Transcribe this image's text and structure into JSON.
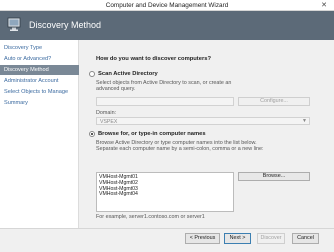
{
  "window": {
    "title": "Computer and Device Management Wizard"
  },
  "header": {
    "title": "Discovery Method"
  },
  "nav": {
    "items": [
      {
        "label": "Discovery Type",
        "active": false
      },
      {
        "label": "Auto or Advanced?",
        "active": false
      },
      {
        "label": "Discovery Method",
        "active": true
      },
      {
        "label": "Administrator Account",
        "active": false
      },
      {
        "label": "Select Objects to Manage",
        "active": false
      },
      {
        "label": "Summary",
        "active": false
      }
    ]
  },
  "main": {
    "question": "How do you want to discover computers?",
    "scan_ad": {
      "label": "Scan Active Directory",
      "description": "Select objects from Active Directory to scan, or create an advanced query.",
      "configure_label": "Configure...",
      "domain_label": "Domain:",
      "domain_value": "VSPEX"
    },
    "browse": {
      "label": "Browse for, or type-in computer names",
      "description": "Browse Active Directory or type computer names into the list below. Separate each computer name by a semi-colon, comma or a new line:",
      "names": [
        "VMHost-Mgmt01",
        "VMHost-Mgmt02",
        "VMHost-Mgmt03",
        "VMHost-Mgmt04"
      ],
      "browse_label": "Browse...",
      "example": "For example, server1.contoso.com or server1"
    }
  },
  "footer": {
    "previous": "< Previous",
    "next": "Next >",
    "discover": "Discover",
    "cancel": "Cancel"
  }
}
